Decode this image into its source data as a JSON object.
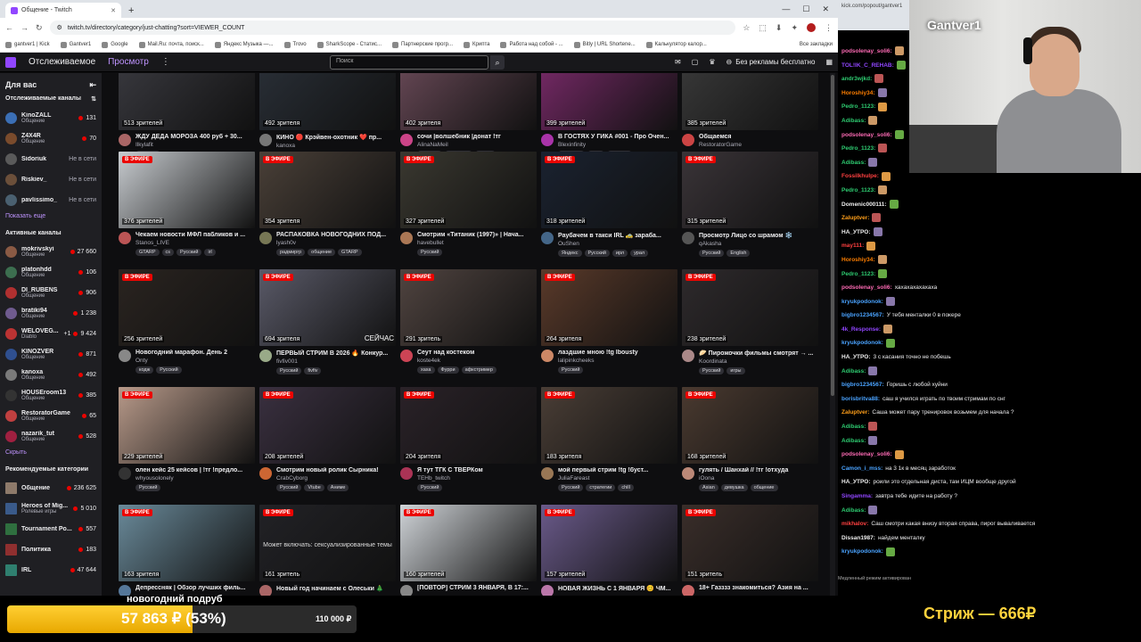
{
  "browser": {
    "tab_title": "Общение - Twitch",
    "url": "twitch.tv/directory/category/just-chatting?sort=VIEWER_COUNT",
    "bookmarks": [
      "gantver1 | Kick",
      "Gantver1",
      "Google",
      "Mail.Ru: почта, поиск...",
      "Яндекс Музыка —...",
      "Trovo",
      "SharkScope - Статис...",
      "Партнерские прогр...",
      "Крипта",
      "Работа над собой - ...",
      "Bitly | URL Shortene...",
      "Калькулятор калор..."
    ],
    "all_bookmarks": "Все закладки"
  },
  "nav": {
    "following": "Отслеживаемое",
    "browse": "Просмотр",
    "search_placeholder": "Поиск",
    "ad_free": "Без рекламы бесплатно"
  },
  "sidebar": {
    "for_you": "Для вас",
    "followed": "Отслеживаемые каналы",
    "followed_channels": [
      {
        "name": "KinoZALL",
        "cat": "Общение",
        "viewers": "131",
        "live": true,
        "color": "#3b6fb5"
      },
      {
        "name": "Z4X4R",
        "cat": "Общение",
        "viewers": "70",
        "live": true,
        "color": "#7a4b2c"
      },
      {
        "name": "Sidoriuk",
        "cat": "",
        "viewers": "Не в сети",
        "live": false,
        "color": "#5a5a5a"
      },
      {
        "name": "Riskiev_",
        "cat": "",
        "viewers": "Не в сети",
        "live": false,
        "color": "#6b4f3a"
      },
      {
        "name": "pavlissimo_",
        "cat": "",
        "viewers": "Не в сети",
        "live": false,
        "color": "#4a6070"
      }
    ],
    "show_more": "Показать еще",
    "active": "Активные каналы",
    "active_channels": [
      {
        "name": "mokrivskyi",
        "cat": "Общение",
        "viewers": "27 660",
        "color": "#8a5a44"
      },
      {
        "name": "platonhdd",
        "cat": "Общение",
        "viewers": "106",
        "color": "#3c6e4f"
      },
      {
        "name": "DI_RUBENS",
        "cat": "Общение",
        "viewers": "906",
        "color": "#b03030"
      },
      {
        "name": "bratiki94",
        "cat": "Общение",
        "viewers": "1 238",
        "color": "#6f5b8f"
      },
      {
        "name": "WELOVEG...",
        "cat": "Diablo",
        "viewers": "9 424",
        "extra": "+1",
        "color": "#b33"
      },
      {
        "name": "KINOZVER",
        "cat": "Общение",
        "viewers": "871",
        "color": "#2f4f8f"
      },
      {
        "name": "kanoxa",
        "cat": "Общение",
        "viewers": "492",
        "color": "#7a7a7a"
      },
      {
        "name": "HOUSEroom13",
        "cat": "Общение",
        "viewers": "385",
        "color": "#333"
      },
      {
        "name": "RestoratorGame",
        "cat": "Общение",
        "viewers": "65",
        "color": "#c04040"
      },
      {
        "name": "nazarik_tut",
        "cat": "Общение",
        "viewers": "528",
        "color": "#a02040"
      }
    ],
    "hide": "Скрыть",
    "recommended": "Рекомендуемые категории",
    "categories": [
      {
        "name": "Общение",
        "sub": "",
        "viewers": "236 625",
        "color": "#8e7a6a"
      },
      {
        "name": "Heroes of Mig...",
        "sub": "Ролевые игры",
        "viewers": "5 010",
        "color": "#3a5a8a"
      },
      {
        "name": "Tournament Po...",
        "sub": "",
        "viewers": "557",
        "color": "#2f6f3f"
      },
      {
        "name": "Политика",
        "sub": "",
        "viewers": "183",
        "color": "#8f2f2f"
      },
      {
        "name": "IRL",
        "sub": "",
        "viewers": "47 644",
        "color": "#2f7f6f"
      }
    ]
  },
  "live_label": "В ЭФИРЕ",
  "streams": [
    {
      "viewers": "513 зрителей",
      "title": "ЖДУ ДЕДА МОРОЗА 400 руб + 30...",
      "channel": "Ilkylafit",
      "tags": [
        "Русский"
      ],
      "thumb": "#3a3a40",
      "av": "#a66"
    },
    {
      "viewers": "492 зрителя",
      "title": "КИНО 🔴 Крэйвен-охотник ❤️ пр...",
      "channel": "kanoxa",
      "tags": [
        "Рекомендация",
        "киновечер"
      ],
      "thumb": "#2a3038",
      "av": "#777"
    },
    {
      "viewers": "402 зрителя",
      "title": "сочи |волшебник |донат !тг",
      "channel": "AlinaNaMeil",
      "tags": [
        "Русский",
        "юморист",
        "радио"
      ],
      "thumb": "#6a4a58",
      "av": "#c48"
    },
    {
      "viewers": "399 зрителей",
      "title": "В ГОСТЯХ У ГИКА #001 - Про Очен...",
      "channel": "Blexinfinity",
      "tags": [
        "Игровые",
        "Saul",
        "Русский"
      ],
      "thumb": "#7a2a6a",
      "av": "#a3a"
    },
    {
      "viewers": "385 зрителей",
      "title": "Общаемся",
      "channel": "RestoratorGame",
      "tags": [],
      "thumb": "#3a3a3a",
      "av": "#c44"
    },
    {
      "viewers": "376 зрителей",
      "title": "Чекаем новости МФЛ пабликов и ...",
      "channel": "Stanos_LIVE",
      "tags": [
        "GTARP",
        "cs",
        "Русский",
        "irl"
      ],
      "thumb": "#c8ccd0",
      "av": "#b55"
    },
    {
      "viewers": "354 зрителя",
      "title": "РАСПАКОВКА НОВОГОДНИХ ПОД...",
      "channel": "lyash0v",
      "tags": [
        "радмирrp",
        "общение",
        "GTARP"
      ],
      "thumb": "#4a4038",
      "av": "#775"
    },
    {
      "viewers": "327 зрителей",
      "title": "Смотрим «Титаник (1997)» | Нача...",
      "channel": "havebullet",
      "tags": [
        "Русский"
      ],
      "thumb": "#3a3830",
      "av": "#a75"
    },
    {
      "viewers": "318 зрителей",
      "title": "Раубачем в такси IRL 🚕 зараба...",
      "channel": "OuShen",
      "tags": [
        "Яндекс",
        "Русский",
        "ирл",
        "урал"
      ],
      "thumb": "#1a2230",
      "av": "#468"
    },
    {
      "viewers": "315 зрителей",
      "title": "Просмотр Лицо со шрамом ❄️",
      "channel": "qAkasha",
      "tags": [
        "Русский",
        "English"
      ],
      "thumb": "#3a3438",
      "av": "#555"
    },
    {
      "viewers": "256 зрителей",
      "title": "Новогодний марафон. День 2",
      "channel": "Onty",
      "tags": [
        "кодж",
        "Русский"
      ],
      "thumb": "#2a2420",
      "av": "#888"
    },
    {
      "viewers": "694 зрителя",
      "title": "ПЕРВЫЙ СТРИМ В 2026 🔥 Конкур...",
      "channel": "fivfiv001",
      "tags": [
        "Русский",
        "fivfiv"
      ],
      "thumb": "#5a5a68",
      "av": "#9a8"
    },
    {
      "viewers": "291 зритель",
      "title": "Сеут над костеком",
      "channel": "koste4ek",
      "tags": [
        "хаха",
        "Фурри",
        "афкстример"
      ],
      "thumb": "#504440",
      "av": "#c45"
    },
    {
      "viewers": "264 зрителя",
      "title": "лаздшие мною !tg lbousty",
      "channel": "lalipinkcheeks",
      "tags": [
        "Русский"
      ],
      "thumb": "#5a3a2a",
      "av": "#c86"
    },
    {
      "viewers": "238 зрителей",
      "title": "🥟 Пирожочки фильмы смотрят → ...",
      "channel": "Koordinata",
      "tags": [
        "Русский",
        "игры"
      ],
      "thumb": "#2e2a2c",
      "av": "#a88"
    },
    {
      "viewers": "229 зрителей",
      "title": "олен кейс 25 кейсов | !тг !предло...",
      "channel": "whyousolonely",
      "tags": [
        "Русский"
      ],
      "thumb": "#b89a8a",
      "av": "#333"
    },
    {
      "viewers": "208 зрителей",
      "title": "Смотрим новый ролик Сырника!",
      "channel": "CrabCyborg",
      "tags": [
        "Русский",
        "Vtube",
        "Аниме"
      ],
      "thumb": "#3a3040",
      "av": "#c63"
    },
    {
      "viewers": "204 зрителя",
      "title": "Я тут ТГК С ТВЕРКом",
      "channel": "TEHb_twitch",
      "tags": [
        "Русский"
      ],
      "thumb": "#2a2228",
      "av": "#a35"
    },
    {
      "viewers": "183 зрителя",
      "title": "мой первый стрим !tg !буст...",
      "channel": "JuliaFareast",
      "tags": [
        "Русский",
        "стратегии",
        "chill"
      ],
      "thumb": "#4a3e36",
      "av": "#975"
    },
    {
      "viewers": "168 зрителей",
      "title": "гулять / Шанхай // !тг !отхуда",
      "channel": "iOona",
      "tags": [
        "Asian",
        "девушка",
        "общение"
      ],
      "thumb": "#4a3a30",
      "av": "#b87"
    },
    {
      "viewers": "163 зрителя",
      "title": "Депрессняк | Обзор лучших филь...",
      "channel": "",
      "tags": [],
      "thumb": "#6a8a9a",
      "av": "#579"
    },
    {
      "viewers": "161 зритель",
      "title": "Новый год начинаем с Олеськи 🎄",
      "channel": "",
      "tags": [],
      "thumb": "#222226",
      "av": "#a66",
      "mature": "Может включать: сексуализированные темы"
    },
    {
      "viewers": "160 зрителей",
      "title": "[ПОВТОР] СТРИМ 3 ЯНВАРЯ, В 17:...",
      "channel": "",
      "tags": [],
      "thumb": "#d0d4d8",
      "av": "#888"
    },
    {
      "viewers": "157 зрителей",
      "title": "НОВАЯ ЖИЗНЬ С 1 ЯНВАРЯ 😊 ЧМ...",
      "channel": "",
      "tags": [],
      "thumb": "#6a5a8a",
      "av": "#b7a"
    },
    {
      "viewers": "151 зритель",
      "title": "18+ Газззз знакомиться? Азия на ...",
      "channel": "",
      "tags": [],
      "thumb": "#3a2e2a",
      "av": "#c66"
    }
  ],
  "overlay_top": "деда",
  "now_tag": "СЕЙЧАС",
  "chat": {
    "url": "kick.com/popout/gantver1",
    "messages": [
      {
        "user": "podsolenay_soli6:",
        "text": "",
        "color": "#ff6bb5"
      },
      {
        "user": "TOL!IK_C_REHAB:",
        "text": "",
        "color": "#9146ff"
      },
      {
        "user": "andr3wjkd:",
        "text": "",
        "color": "#2ecc71"
      },
      {
        "user": "Horoshiy34:",
        "text": "",
        "color": "#ff7f00"
      },
      {
        "user": "Pedro_1123:",
        "text": "",
        "color": "#2ecc71"
      },
      {
        "user": "Adibass:",
        "text": "",
        "color": "#2ecc71"
      },
      {
        "user": "podsolenay_soli6:",
        "text": "",
        "color": "#ff6bb5"
      },
      {
        "user": "Pedro_1123:",
        "text": "",
        "color": "#2ecc71"
      },
      {
        "user": "Adibass:",
        "text": "",
        "color": "#2ecc71"
      },
      {
        "user": "Fossilkhulpe:",
        "text": "",
        "color": "#ff4040"
      },
      {
        "user": "Pedro_1123:",
        "text": "",
        "color": "#2ecc71"
      },
      {
        "user": "Domenic000111:",
        "text": "",
        "color": "#eee"
      },
      {
        "user": "Zaluptver:",
        "text": "",
        "color": "#ff9f1a"
      },
      {
        "user": "НА_УТРО:",
        "text": "",
        "color": "#eee"
      },
      {
        "user": "may111:",
        "text": "",
        "color": "#ff4040"
      },
      {
        "user": "Horoshiy34:",
        "text": "",
        "color": "#ff7f00"
      },
      {
        "user": "Pedro_1123:",
        "text": "",
        "color": "#2ecc71"
      },
      {
        "user": "podsolenay_soli6:",
        "text": "хахахахахахаха",
        "color": "#ff6bb5"
      },
      {
        "user": "kryukpodonok:",
        "text": "",
        "color": "#4aa3ff"
      },
      {
        "user": "bigbro1234567:",
        "text": "У тебя менталки 0 в покере",
        "color": "#4aa3ff"
      },
      {
        "user": "4k_Response:",
        "text": "",
        "color": "#9146ff"
      },
      {
        "user": "kryukpodonok:",
        "text": "",
        "color": "#4aa3ff"
      },
      {
        "user": "НА_УТРО:",
        "text": "3 с касания точно не побешь",
        "color": "#eee"
      },
      {
        "user": "Adibass:",
        "text": "",
        "color": "#2ecc71"
      },
      {
        "user": "bigbro1234567:",
        "text": "Горишь с любой хуйни",
        "color": "#4aa3ff"
      },
      {
        "user": "borisbritva88:",
        "text": "саш я учился играть по твоим стримам по снг",
        "color": "#4aa3ff"
      },
      {
        "user": "Zaluptver:",
        "text": "Саша может пару тренировок возьмем для начала ?",
        "color": "#ff9f1a"
      },
      {
        "user": "Adibass:",
        "text": "",
        "color": "#2ecc71"
      },
      {
        "user": "Adibass:",
        "text": "",
        "color": "#2ecc71"
      },
      {
        "user": "podsolenay_soli6:",
        "text": "",
        "color": "#ff6bb5"
      },
      {
        "user": "Camon_i_mss:",
        "text": "на 3 1к в месяц заработок",
        "color": "#4aa3ff"
      },
      {
        "user": "НА_УТРО:",
        "text": "роили это отдельная диста, там ИЦМ вообще другой",
        "color": "#eee"
      },
      {
        "user": "Singamma:",
        "text": "завтра тебе идите на работу ?",
        "color": "#9146ff"
      },
      {
        "user": "Adibass:",
        "text": "",
        "color": "#2ecc71"
      },
      {
        "user": "mikhalov:",
        "text": "Саш смотри какая внизу вторая справа, пирог вываливается",
        "color": "#ff4040"
      },
      {
        "user": "Dissan1987:",
        "text": "найдем менталку",
        "color": "#eee"
      },
      {
        "user": "kryukpodonok:",
        "text": "",
        "color": "#4aa3ff"
      }
    ],
    "slow_mode": "Медленный режим активирован"
  },
  "webcam": {
    "name": "Gantver1"
  },
  "goal": {
    "title": "новогодний подруб",
    "amount": "57 863 ₽ (53%)",
    "target": "110 000 ₽",
    "progress": 0.53
  },
  "donation": "Стриж — 666₽"
}
